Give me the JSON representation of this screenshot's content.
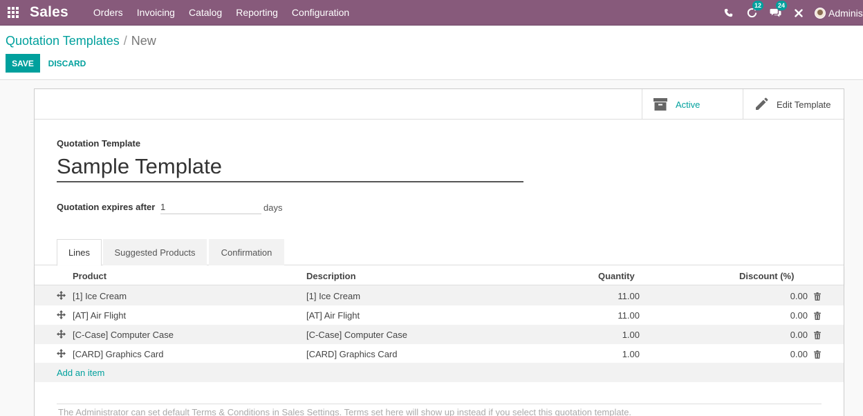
{
  "navbar": {
    "app_name": "Sales",
    "menu": [
      "Orders",
      "Invoicing",
      "Catalog",
      "Reporting",
      "Configuration"
    ],
    "activity_count": "12",
    "messages_count": "24",
    "user_name": "Administrator",
    "color": "#875a7b",
    "icons": [
      "apps-grid-icon",
      "phone-icon",
      "activity-icon",
      "chat-icon",
      "close-icon",
      "avatar"
    ]
  },
  "breadcrumb": {
    "parent": "Quotation Templates",
    "separator": "/",
    "current": "New"
  },
  "buttons": {
    "save": "SAVE",
    "discard": "DISCARD"
  },
  "stat_buttons": {
    "active": "Active",
    "edit": "Edit Template"
  },
  "form": {
    "title_label": "Quotation Template",
    "title_value": "Sample Template",
    "expire_label": "Quotation expires after",
    "expire_value": "1",
    "expire_unit": "days"
  },
  "tabs": [
    "Lines",
    "Suggested Products",
    "Confirmation"
  ],
  "table": {
    "headers": {
      "product": "Product",
      "description": "Description",
      "quantity": "Quantity",
      "discount": "Discount (%)"
    },
    "rows": [
      {
        "product": "[1] Ice Cream",
        "description": "[1] Ice Cream",
        "quantity": "11.00",
        "discount": "0.00"
      },
      {
        "product": "[AT] Air Flight",
        "description": "[AT] Air Flight",
        "quantity": "11.00",
        "discount": "0.00"
      },
      {
        "product": "[C-Case] Computer Case",
        "description": "[C-Case] Computer Case",
        "quantity": "1.00",
        "discount": "0.00"
      },
      {
        "product": "[CARD] Graphics Card",
        "description": "[CARD] Graphics Card",
        "quantity": "1.00",
        "discount": "0.00"
      }
    ],
    "add_item": "Add an item"
  },
  "terms_placeholder": "The Administrator can set default Terms & Conditions in Sales Settings. Terms set here will show up instead if you select this quotation template.",
  "colors": {
    "accent": "#00a09d",
    "navbar": "#875a7b"
  }
}
